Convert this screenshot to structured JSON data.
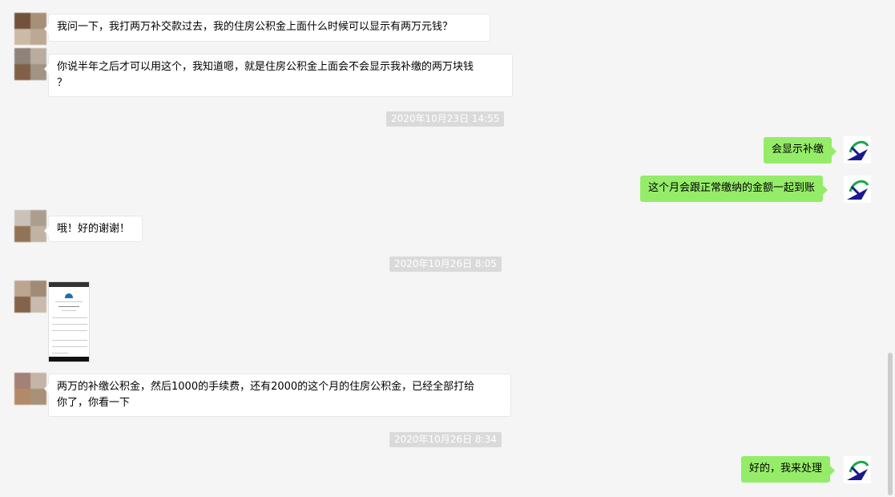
{
  "messages": {
    "m1": "我问一下，我打两万补交款过去，我的住房公积金上面什么时候可以显示有两万元钱？",
    "m2_line1": "你说半年之后才可以用这个，我知道嗯，就是住房公积金上面会不会显示我补缴的两万块钱",
    "m2_line2": "？",
    "ts1": "2020年10月23日 14:55",
    "r1": "会显示补缴",
    "r2": "这个月会跟正常缴纳的金额一起到账",
    "m3": "哦！好的谢谢！",
    "ts2": "2020年10月26日 8:05",
    "m4_line1": " 两万的补缴公积金，然后1000的手续费，还有2000的这个月的住房公积金，已经全部打给",
    "m4_line2": "你了，你看一下",
    "ts3": "2020年10月26日 8:34",
    "r3": "好的，我来处理"
  },
  "colors": {
    "sent_bubble": "#95ec69",
    "received_bubble": "#ffffff",
    "background": "#f5f5f5",
    "timestamp_bg": "#dadada",
    "logo_blue": "#1a1a8c",
    "logo_green": "#1aa84a"
  },
  "icons": {
    "my_avatar": "swoosh-logo-icon",
    "contact_avatar": "pixelated-avatar"
  }
}
